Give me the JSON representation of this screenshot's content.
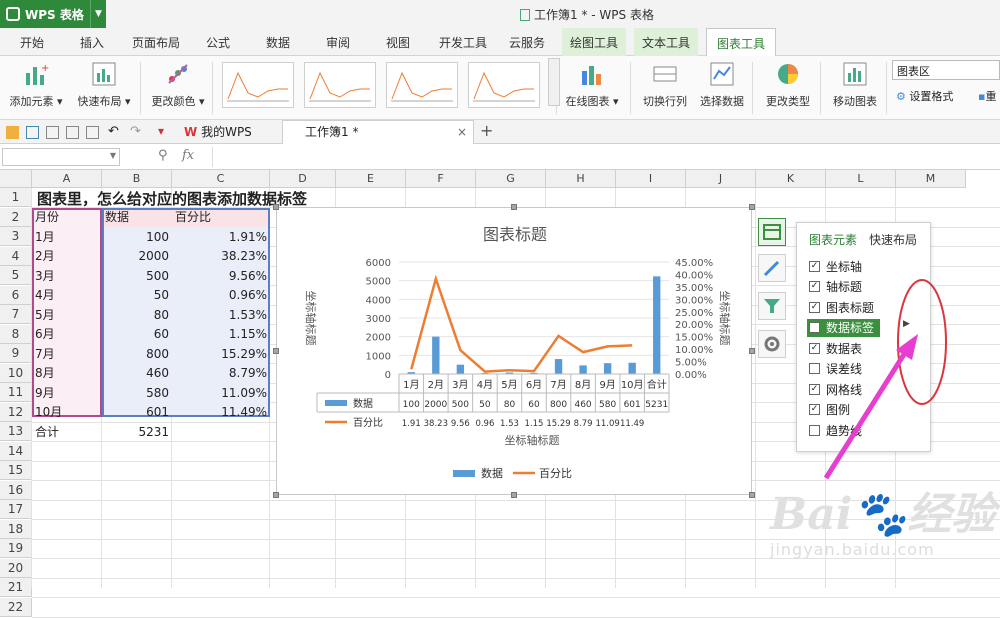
{
  "app": {
    "name": "WPS 表格",
    "window_title": "工作簿1 * - WPS 表格"
  },
  "tabs": [
    "开始",
    "插入",
    "页面布局",
    "公式",
    "数据",
    "审阅",
    "视图",
    "开发工具",
    "云服务",
    "绘图工具",
    "文本工具",
    "图表工具"
  ],
  "ribbon": {
    "add_element": "添加元素",
    "quick_layout": "快速布局",
    "change_color": "更改颜色",
    "online_chart": "在线图表",
    "switch_rowcol": "切换行列",
    "select_data": "选择数据",
    "change_type": "更改类型",
    "move_chart": "移动图表",
    "chart_area": "图表区",
    "set_format": "设置格式",
    "reset": "重"
  },
  "doc_tabs": {
    "mywps": "我的WPS",
    "book": "工作簿1 *"
  },
  "formula_bar": {
    "fx": "fx"
  },
  "columns": [
    "A",
    "B",
    "C",
    "D",
    "E",
    "F",
    "G",
    "H",
    "I",
    "J",
    "K",
    "L",
    "M"
  ],
  "rows": [
    "1",
    "2",
    "3",
    "4",
    "5",
    "6",
    "7",
    "8",
    "9",
    "10",
    "11",
    "12",
    "13",
    "14",
    "15",
    "16",
    "17",
    "18",
    "19",
    "20",
    "21",
    "22"
  ],
  "sheet": {
    "title": "图表里，怎么给对应的图表添加数据标签",
    "headers": [
      "月份",
      "数据",
      "百分比"
    ],
    "data": [
      [
        "1月",
        "100",
        "1.91%"
      ],
      [
        "2月",
        "2000",
        "38.23%"
      ],
      [
        "3月",
        "500",
        "9.56%"
      ],
      [
        "4月",
        "50",
        "0.96%"
      ],
      [
        "5月",
        "80",
        "1.53%"
      ],
      [
        "6月",
        "60",
        "1.15%"
      ],
      [
        "7月",
        "800",
        "15.29%"
      ],
      [
        "8月",
        "460",
        "8.79%"
      ],
      [
        "9月",
        "580",
        "11.09%"
      ],
      [
        "10月",
        "601",
        "11.49%"
      ]
    ],
    "total": [
      "合计",
      "5231"
    ]
  },
  "chart_data": {
    "type": "bar",
    "title": "图表标题",
    "xlabel": "坐标轴标题",
    "ylabel": "坐标轴标题",
    "y2label": "坐标轴标题",
    "categories": [
      "1月",
      "2月",
      "3月",
      "4月",
      "5月",
      "6月",
      "7月",
      "8月",
      "9月",
      "10月",
      "合计"
    ],
    "ylim": [
      0,
      6000
    ],
    "yticks": [
      "0",
      "1000",
      "2000",
      "3000",
      "4000",
      "5000",
      "6000"
    ],
    "y2lim": [
      0,
      45
    ],
    "y2ticks": [
      "0.00%",
      "5.00%",
      "10.00%",
      "15.00%",
      "20.00%",
      "25.00%",
      "30.00%",
      "35.00%",
      "40.00%",
      "45.00%"
    ],
    "series": [
      {
        "name": "数据",
        "kind": "bar",
        "color": "#5b9bd5",
        "values": [
          100,
          2000,
          500,
          50,
          80,
          60,
          800,
          460,
          580,
          601,
          5231
        ],
        "labels": [
          "100",
          "2000",
          "500",
          "50",
          "80",
          "60",
          "800",
          "460",
          "580",
          "601",
          "5231"
        ]
      },
      {
        "name": "百分比",
        "kind": "line",
        "color": "#ed7d31",
        "values": [
          1.91,
          38.23,
          9.56,
          0.96,
          1.53,
          1.15,
          15.29,
          8.79,
          11.09,
          11.49
        ],
        "labels": [
          "1.91",
          "38.23",
          "9.56",
          "0.96",
          "1.53",
          "1.15",
          "15.29",
          "8.79",
          "11.09",
          "11.49"
        ]
      }
    ],
    "legend": "bottom"
  },
  "panel": {
    "tab1": "图表元素",
    "tab2": "快速布局",
    "items": [
      {
        "label": "坐标轴",
        "checked": true
      },
      {
        "label": "轴标题",
        "checked": true
      },
      {
        "label": "图表标题",
        "checked": true
      },
      {
        "label": "数据标签",
        "checked": false
      },
      {
        "label": "数据表",
        "checked": true
      },
      {
        "label": "误差线",
        "checked": false
      },
      {
        "label": "网格线",
        "checked": true
      },
      {
        "label": "图例",
        "checked": true
      },
      {
        "label": "趋势线",
        "checked": false
      }
    ]
  },
  "watermark": {
    "brand": "Bai",
    "cn": "经验",
    "url": "jingyan.baidu.com"
  },
  "colors": {
    "accent": "#2e8a3a",
    "bar": "#5b9bd5",
    "line": "#ed7d31",
    "arrow": "#e83ecf",
    "circle": "#d9363e"
  }
}
